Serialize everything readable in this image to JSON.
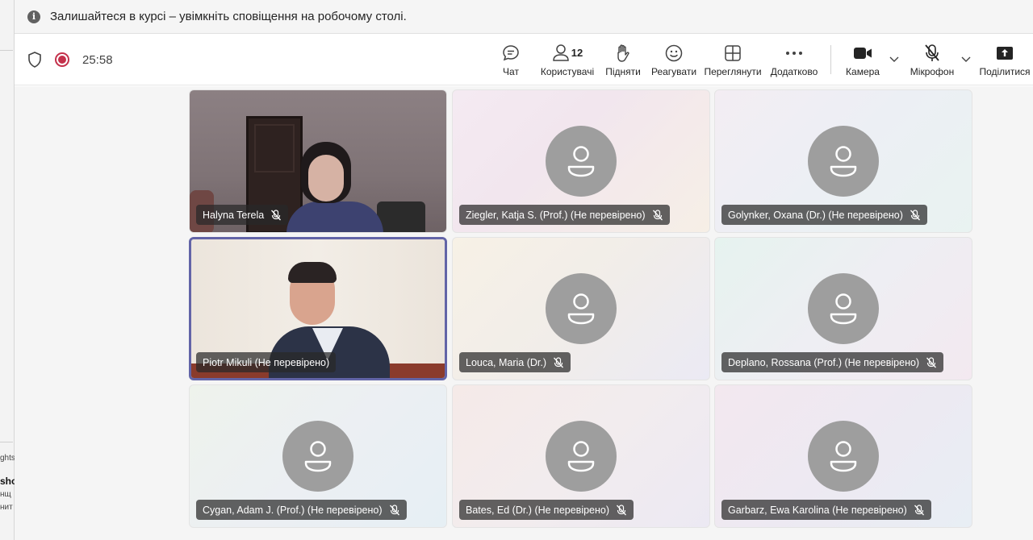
{
  "left_strip": {
    "texts": [
      "ghts",
      "sho",
      "нщ",
      "нит"
    ]
  },
  "banner": {
    "text": "Залишайтеся в курсі – увімкніть сповіщення на робочому столі."
  },
  "toolbar": {
    "timer": "25:58",
    "chat": "Чат",
    "people": "Користувачі",
    "people_count": "12",
    "raise": "Підняти",
    "react": "Реагувати",
    "view": "Переглянути",
    "more": "Додатково",
    "camera": "Камера",
    "mic": "Мікрофон",
    "share": "Поділитися"
  },
  "participants": [
    {
      "name": "Halyna Terela",
      "video": true
    },
    {
      "name": "Ziegler, Katja S. (Prof.) (Не перевірено)",
      "video": false
    },
    {
      "name": "Golynker, Oxana (Dr.) (Не перевірено)",
      "video": false
    },
    {
      "name": "Piotr Mikuli (Не перевірено)",
      "video": true,
      "active_speaker": true
    },
    {
      "name": "Louca, Maria (Dr.)",
      "video": false
    },
    {
      "name": "Deplano, Rossana (Prof.) (Не перевірено)",
      "video": false
    },
    {
      "name": "Cygan, Adam J. (Prof.) (Не перевірено)",
      "video": false
    },
    {
      "name": "Bates, Ed (Dr.) (Не перевірено)",
      "video": false
    },
    {
      "name": "Garbarz, Ewa Karolina (Не перевірено)",
      "video": false
    }
  ],
  "colors": {
    "accent": "#6264a7",
    "record": "#c4314b",
    "avatar": "#9e9e9e"
  }
}
